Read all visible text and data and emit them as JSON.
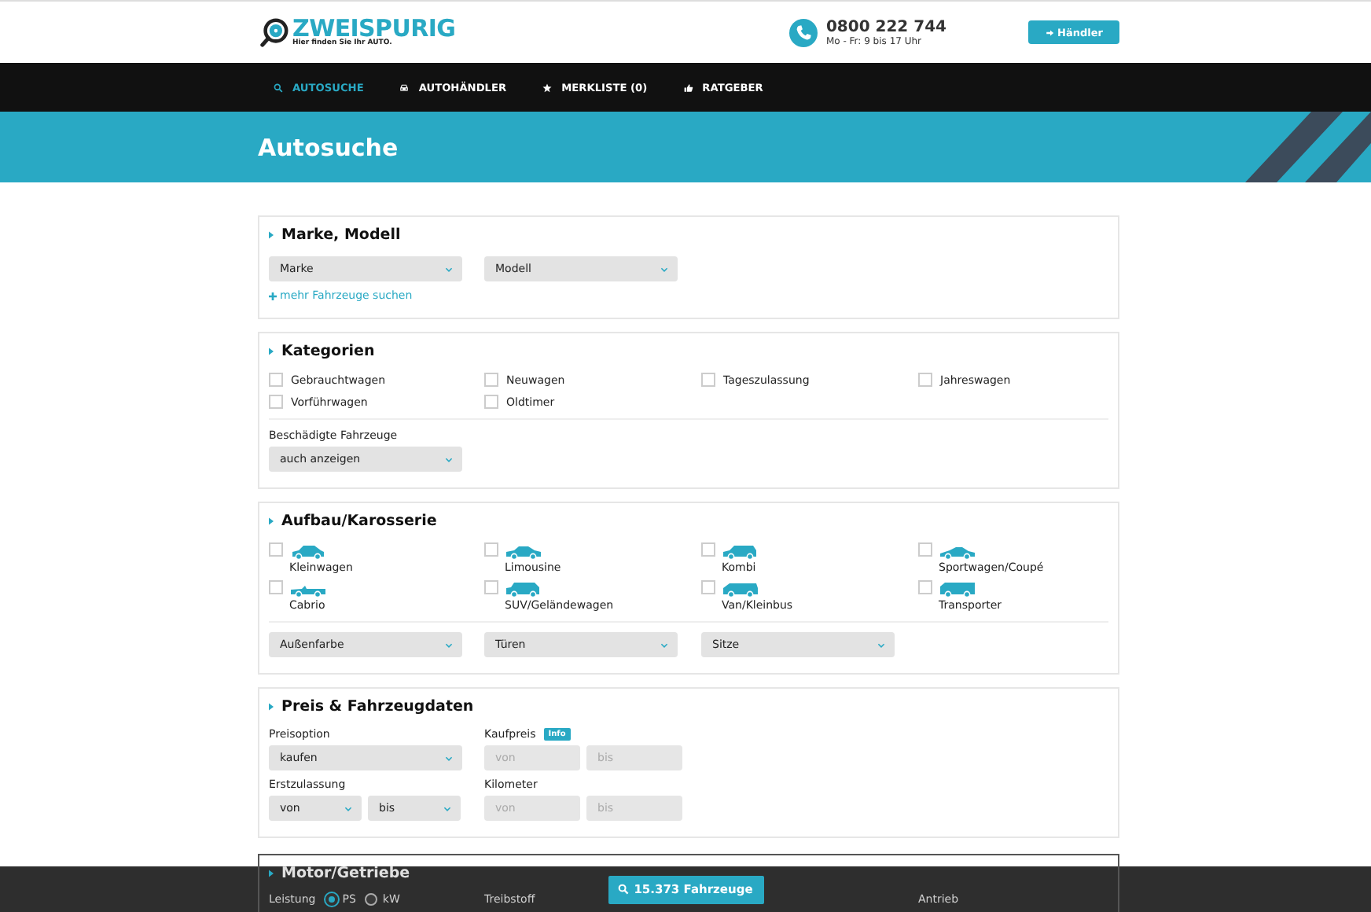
{
  "header": {
    "logo": "ZWEISPURIG",
    "tagline": "Hier finden Sie Ihr AUTO.",
    "phone": "0800 222 744",
    "hours": "Mo - Fr: 9 bis 17 Uhr",
    "dealer_button": "Händler"
  },
  "nav": [
    {
      "label": "AUTOSUCHE",
      "kind": "search",
      "selected": true
    },
    {
      "label": "AUTOHÄNDLER",
      "kind": "car",
      "selected": false
    },
    {
      "label": "MERKLISTE (0)",
      "kind": "star",
      "selected": false
    },
    {
      "label": "RATGEBER",
      "kind": "thumb",
      "selected": false
    }
  ],
  "page_title": "Autosuche",
  "brand_model": {
    "title": "Marke, Modell",
    "selects": [
      "Marke",
      "Modell"
    ],
    "more_link": "mehr Fahrzeuge suchen"
  },
  "categories": {
    "title": "Kategorien",
    "options": [
      {
        "label": "Gebrauchtwagen",
        "checked": false
      },
      {
        "label": "Neuwagen",
        "checked": false
      },
      {
        "label": "Tageszulassung",
        "checked": false
      },
      {
        "label": "Jahreswagen",
        "checked": false
      },
      {
        "label": "Vorführwagen",
        "checked": false
      },
      {
        "label": "Oldtimer",
        "checked": false
      }
    ],
    "damaged": {
      "label": "Beschädigte Fahrzeuge",
      "value": "auch anzeigen"
    }
  },
  "body_type": {
    "title": "Aufbau/Karosserie",
    "options": [
      {
        "label": "Kleinwagen",
        "kind": "small",
        "checked": false
      },
      {
        "label": "Limousine",
        "kind": "sedan",
        "checked": false
      },
      {
        "label": "Kombi",
        "kind": "wagon",
        "checked": false
      },
      {
        "label": "Sportwagen/Coupé",
        "kind": "coupe",
        "checked": false
      },
      {
        "label": "Cabrio",
        "kind": "convertible",
        "checked": false
      },
      {
        "label": "SUV/Geländewagen",
        "kind": "suv",
        "checked": false
      },
      {
        "label": "Van/Kleinbus",
        "kind": "van",
        "checked": false
      },
      {
        "label": "Transporter",
        "kind": "transporter",
        "checked": false
      }
    ],
    "selects": [
      "Außenfarbe",
      "Türen",
      "Sitze"
    ]
  },
  "price_data": {
    "title": "Preis & Fahrzeugdaten",
    "price_option": {
      "label": "Preisoption",
      "value": "kaufen"
    },
    "purchase_price": {
      "label": "Kaufpreis",
      "badge": "Info",
      "from": {
        "placeholder": "von"
      },
      "to": {
        "placeholder": "bis"
      }
    },
    "first_registration": {
      "label": "Erstzulassung",
      "from": "von",
      "to": "bis"
    },
    "mileage": {
      "label": "Kilometer",
      "from": {
        "placeholder": "von"
      },
      "to": {
        "placeholder": "bis"
      }
    }
  },
  "motor": {
    "title": "Motor/Getriebe",
    "power": {
      "label": "Leistung",
      "units": [
        {
          "label": "PS",
          "selected": true
        },
        {
          "label": "kW",
          "selected": false
        }
      ]
    },
    "fuel_label": "Treibstoff",
    "drive_label": "Antrieb"
  },
  "results_button": "15.373 Fahrzeuge"
}
